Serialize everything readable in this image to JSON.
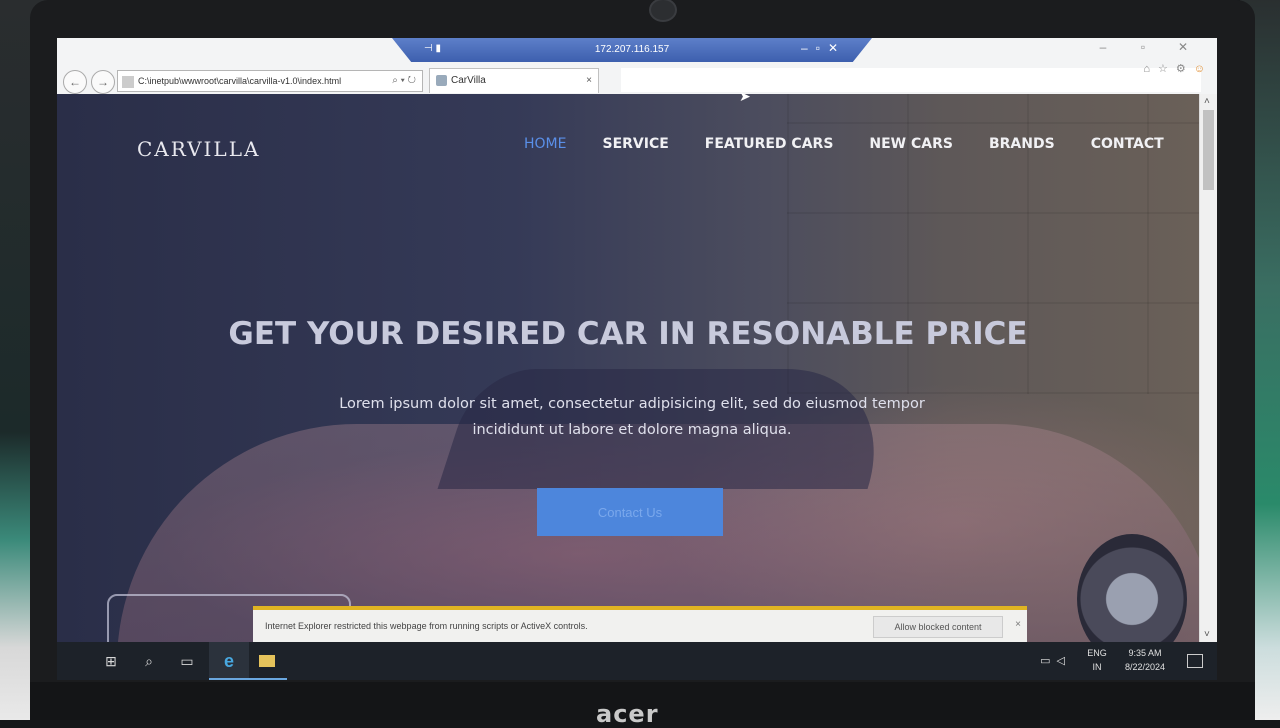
{
  "browser": {
    "remote_host": "172.207.116.157",
    "address": "C:\\inetpub\\wwwroot\\carvilla\\carvilla-v1.0\\index.html",
    "tab_title": "CarVilla",
    "tab_close": "×"
  },
  "site": {
    "logo": "CARVILLA",
    "menu": [
      "HOME",
      "SERVICE",
      "FEATURED CARS",
      "NEW CARS",
      "BRANDS",
      "CONTACT"
    ],
    "hero_title": "GET YOUR DESIRED CAR IN RESONABLE PRICE",
    "hero_subtitle": "Lorem ipsum dolor sit amet, consectetur adipisicing elit, sed do eiusmod tempor incididunt ut labore et dolore magna aliqua.",
    "cta_label": "Contact Us"
  },
  "infobar": {
    "message": "Internet Explorer restricted this webpage from running scripts or ActiveX controls.",
    "allow_label": "Allow blocked content",
    "close": "×"
  },
  "taskbar": {
    "lang_top": "ENG",
    "lang_bottom": "IN",
    "time": "9:35 AM",
    "date": "8/22/2024"
  },
  "device": {
    "brand": "acer"
  }
}
